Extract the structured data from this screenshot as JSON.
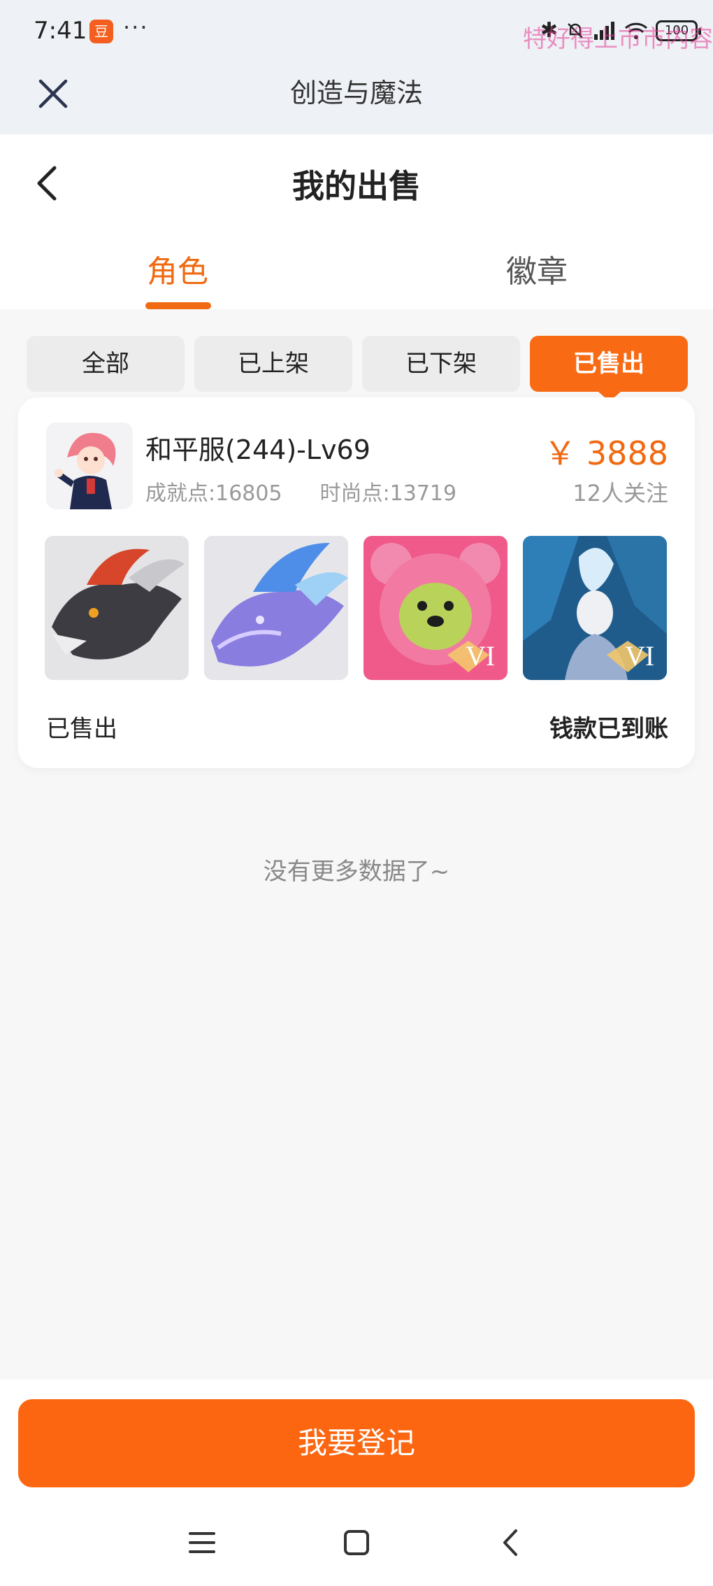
{
  "status_bar": {
    "time": "7:41",
    "app_icon_glyph": "豆",
    "more": "···",
    "bluetooth": "✱",
    "battery": "100",
    "watermark": "特好得上市市内容"
  },
  "app_bar": {
    "title": "创造与魔法"
  },
  "header": {
    "title": "我的出售"
  },
  "tabs": [
    {
      "label": "角色",
      "active": true
    },
    {
      "label": "徽章",
      "active": false
    }
  ],
  "filters": [
    {
      "label": "全部",
      "active": false
    },
    {
      "label": "已上架",
      "active": false
    },
    {
      "label": "已下架",
      "active": false
    },
    {
      "label": "已售出",
      "active": true
    }
  ],
  "listing": {
    "name": "和平服(244)-Lv69",
    "achievement": "成就点:16805",
    "fashion": "时尚点:13719",
    "price": "￥ 3888",
    "followers": "12人关注",
    "items": [
      {
        "icon": "black-dragon-mount-icon"
      },
      {
        "icon": "blue-dragon-mount-icon"
      },
      {
        "icon": "pink-bear-costume-icon",
        "badge": "VI"
      },
      {
        "icon": "ice-wing-character-icon",
        "badge": "VI"
      }
    ],
    "status": "已售出",
    "payment_status": "钱款已到账"
  },
  "empty_message": "没有更多数据了~",
  "register_button": "我要登记",
  "colors": {
    "accent": "#f96a14",
    "text_primary": "#222222",
    "text_secondary": "#999999",
    "background": "#f7f7f7"
  }
}
